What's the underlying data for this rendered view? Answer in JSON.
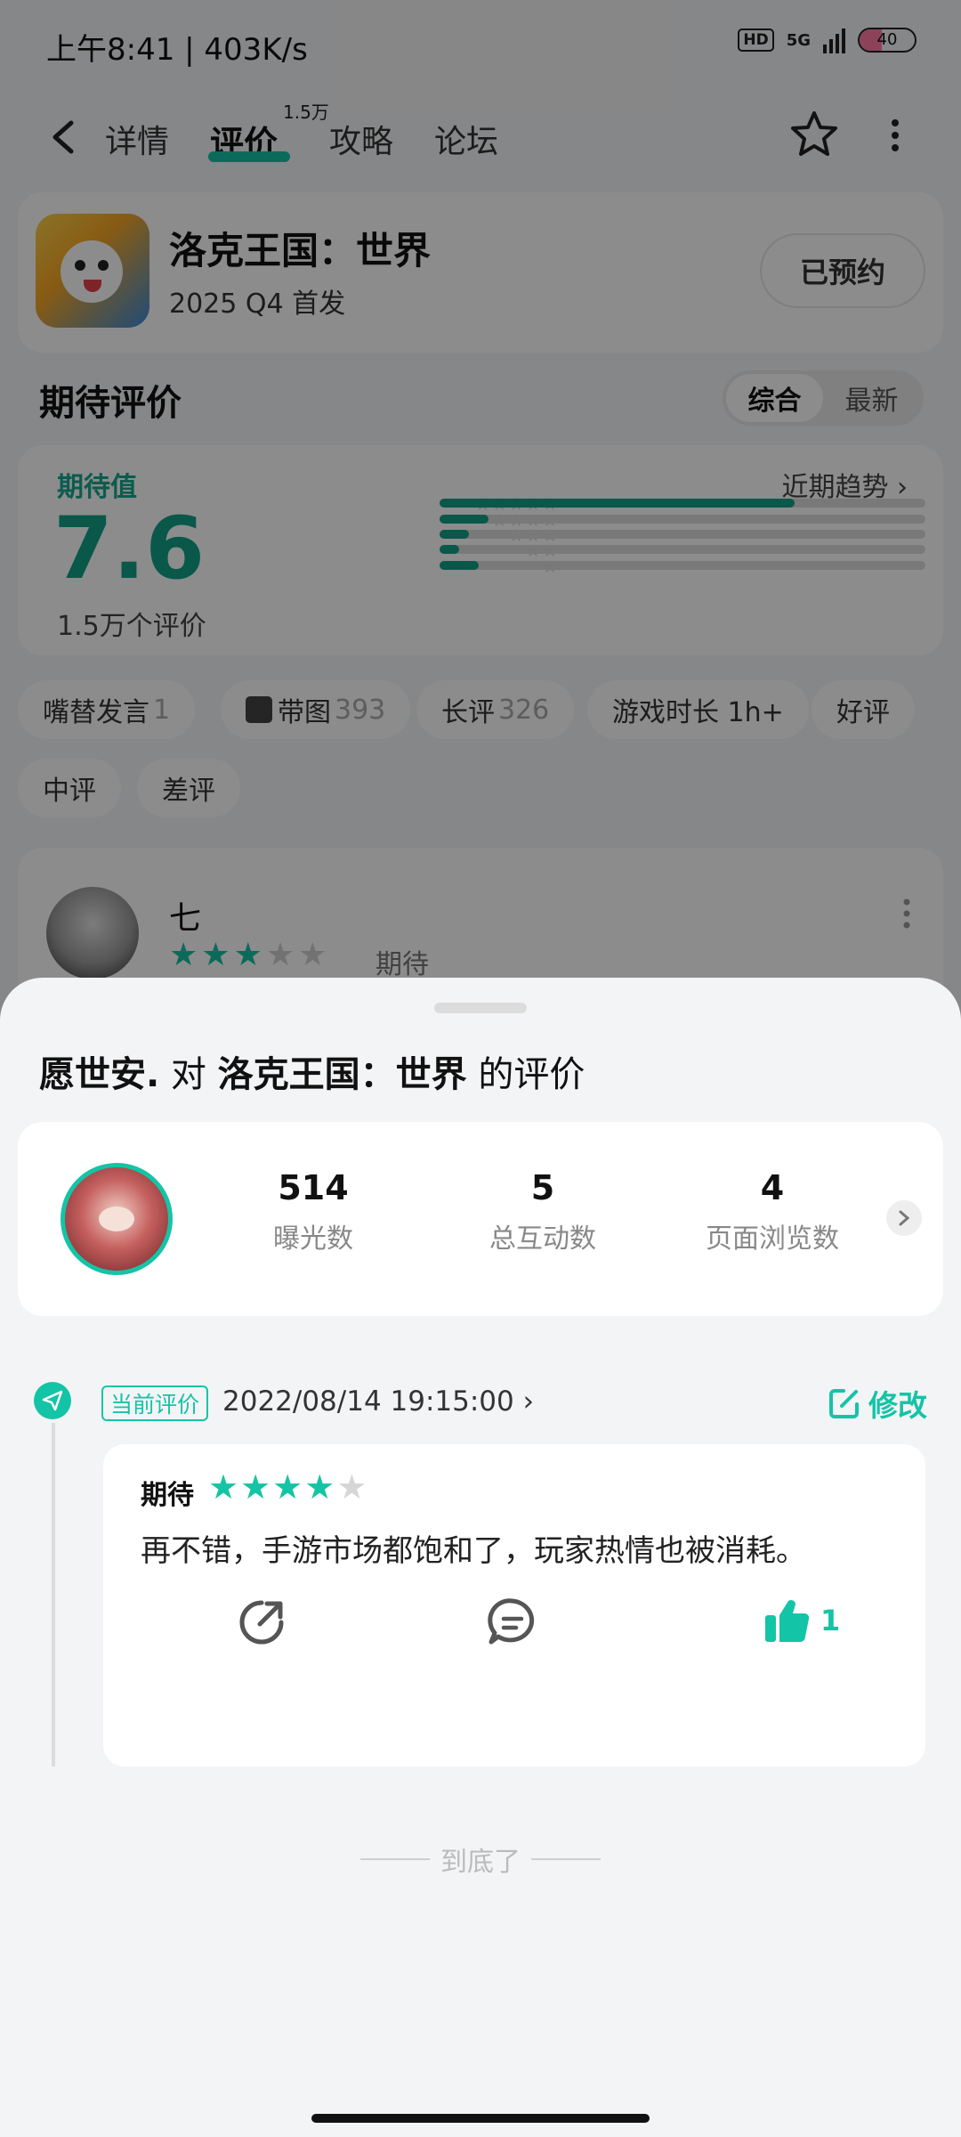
{
  "status_bar": {
    "time_speed": "上午8:41 | 403K/s",
    "hd": "HD",
    "network": "5G",
    "battery": "40",
    "battery_level": 0.4
  },
  "nav": {
    "tabs": [
      {
        "label": "详情",
        "active": false
      },
      {
        "label": "评价",
        "active": true,
        "badge": "1.5万"
      },
      {
        "label": "攻略",
        "active": false
      },
      {
        "label": "论坛",
        "active": false
      }
    ]
  },
  "game": {
    "title": "洛克王国：世界",
    "release": "2025 Q4 首发",
    "reserved_label": "已预约"
  },
  "expectation": {
    "section_title": "期待评价",
    "sort_options": [
      "综合",
      "最新"
    ],
    "label": "期待值",
    "score": "7.6",
    "count": "1.5万个评价",
    "trend_link": "近期趋势 ›",
    "distribution": [
      {
        "stars": 5,
        "fraction": 0.73
      },
      {
        "stars": 4,
        "fraction": 0.1
      },
      {
        "stars": 3,
        "fraction": 0.06
      },
      {
        "stars": 2,
        "fraction": 0.04
      },
      {
        "stars": 1,
        "fraction": 0.08
      }
    ]
  },
  "filter_tags": [
    {
      "label": "嘴替发言",
      "count": "1"
    },
    {
      "label": "带图",
      "count": "393",
      "icon": "image-icon"
    },
    {
      "label": "长评",
      "count": "326"
    },
    {
      "label": "游戏时长 1h+",
      "count": ""
    },
    {
      "label": "好评",
      "count": ""
    },
    {
      "label": "中评",
      "count": ""
    },
    {
      "label": "差评",
      "count": ""
    }
  ],
  "preview_review": {
    "user": "七",
    "stars_on": 3,
    "mood": "期待"
  },
  "sheet": {
    "title_user": "愿世安.",
    "title_mid": " 对 ",
    "title_game": "洛克王国：世界",
    "title_suffix": " 的评价",
    "stats": [
      {
        "value": "514",
        "label": "曝光数"
      },
      {
        "value": "5",
        "label": "总互动数"
      },
      {
        "value": "4",
        "label": "页面浏览数"
      }
    ],
    "current_badge": "当前评价",
    "date": "2022/08/14 19:15:00 ›",
    "edit_label": "修改",
    "review": {
      "mood": "期待",
      "stars_on": 4,
      "text": "再不错，手游市场都饱和了，玩家热情也被消耗。",
      "likes": "1"
    },
    "end_text": "到底了"
  },
  "colors": {
    "accent": "#14c4a6",
    "score": "#12a187"
  }
}
